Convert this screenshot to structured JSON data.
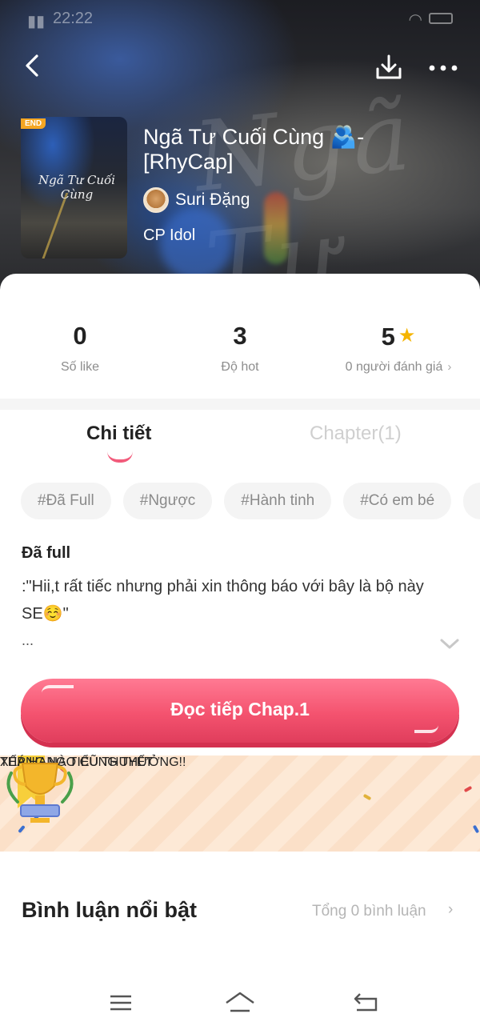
{
  "status_bar": {
    "time": "22:22"
  },
  "story": {
    "badge": "END",
    "cover_text": "Ngã Tư Cuối Cùng",
    "title": "Ngã Tư Cuối Cùng 🫂-[RhyCap]",
    "author": "Suri Đặng",
    "category": "CP Idol"
  },
  "stats": {
    "likes": {
      "value": "0",
      "label": "Số like"
    },
    "hot": {
      "value": "3",
      "label": "Độ hot"
    },
    "rating": {
      "value": "5",
      "label": "0 người đánh giá"
    }
  },
  "tabs": {
    "detail": "Chi tiết",
    "chapter": "Chapter(1)",
    "active": "detail"
  },
  "tags": [
    "#Đã Full",
    "#Ngược",
    "#Hành tinh",
    "#Có em bé"
  ],
  "description": {
    "title": "Đã full",
    "body": ":\"Hii,t rất tiếc nhưng phải xin thông báo với bây là bộ này SE☺️\"",
    "ellipsis": "..."
  },
  "read_button": {
    "label": "Đọc tiếp Chap.1"
  },
  "banner": {
    "line1": "XẾP HẠNG TIỂU THUYẾT",
    "line2": "THÁNG NÀO CŨNG THƯỞNG!!"
  },
  "comments": {
    "title": "Bình luận nổi bật",
    "count_label": "Tổng 0 bình luận"
  },
  "colors": {
    "accent": "#f25b7b",
    "star": "#f5b400",
    "banner_text": "#2147c9"
  },
  "icons": [
    "back-arrow-icon",
    "download-icon",
    "more-icon",
    "star-icon",
    "chevron-right-icon",
    "chevron-down-icon",
    "trophy-icon",
    "menu-icon",
    "home-icon",
    "nav-back-icon"
  ]
}
